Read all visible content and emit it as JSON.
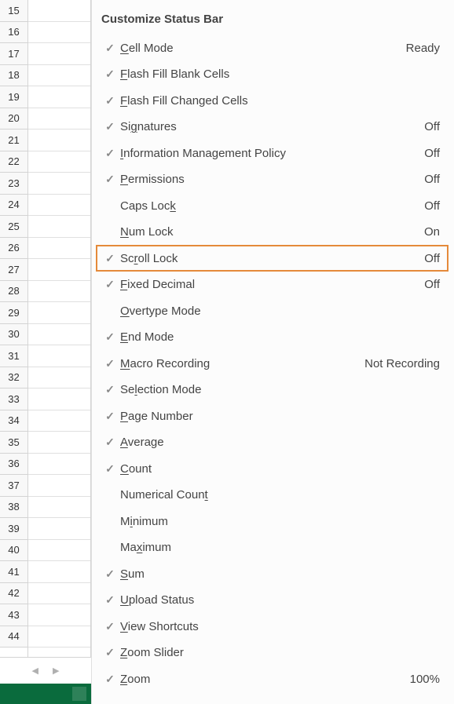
{
  "rows": [
    "15",
    "16",
    "17",
    "18",
    "19",
    "20",
    "21",
    "22",
    "23",
    "24",
    "25",
    "26",
    "27",
    "28",
    "29",
    "30",
    "31",
    "32",
    "33",
    "34",
    "35",
    "36",
    "37",
    "38",
    "39",
    "40",
    "41",
    "42",
    "43",
    "44"
  ],
  "menu": {
    "title": "Customize Status Bar",
    "items": [
      {
        "checked": true,
        "pre": "",
        "u": "C",
        "post": "ell Mode",
        "value": "Ready",
        "highlighted": false
      },
      {
        "checked": true,
        "pre": "",
        "u": "F",
        "post": "lash Fill Blank Cells",
        "value": "",
        "highlighted": false
      },
      {
        "checked": true,
        "pre": "",
        "u": "F",
        "post": "lash Fill Changed Cells",
        "value": "",
        "highlighted": false
      },
      {
        "checked": true,
        "pre": "Si",
        "u": "g",
        "post": "natures",
        "value": "Off",
        "highlighted": false
      },
      {
        "checked": true,
        "pre": "",
        "u": "I",
        "post": "nformation Management Policy",
        "value": "Off",
        "highlighted": false
      },
      {
        "checked": true,
        "pre": "",
        "u": "P",
        "post": "ermissions",
        "value": "Off",
        "highlighted": false
      },
      {
        "checked": false,
        "pre": "Caps Loc",
        "u": "k",
        "post": "",
        "value": "Off",
        "highlighted": false
      },
      {
        "checked": false,
        "pre": "",
        "u": "N",
        "post": "um Lock",
        "value": "On",
        "highlighted": false
      },
      {
        "checked": true,
        "pre": "Sc",
        "u": "r",
        "post": "oll Lock",
        "value": "Off",
        "highlighted": true
      },
      {
        "checked": true,
        "pre": "",
        "u": "F",
        "post": "ixed Decimal",
        "value": "Off",
        "highlighted": false
      },
      {
        "checked": false,
        "pre": "",
        "u": "O",
        "post": "vertype Mode",
        "value": "",
        "highlighted": false
      },
      {
        "checked": true,
        "pre": "",
        "u": "E",
        "post": "nd Mode",
        "value": "",
        "highlighted": false
      },
      {
        "checked": true,
        "pre": "",
        "u": "M",
        "post": "acro Recording",
        "value": "Not Recording",
        "highlighted": false
      },
      {
        "checked": true,
        "pre": "Se",
        "u": "l",
        "post": "ection Mode",
        "value": "",
        "highlighted": false
      },
      {
        "checked": true,
        "pre": "",
        "u": "P",
        "post": "age Number",
        "value": "",
        "highlighted": false
      },
      {
        "checked": true,
        "pre": "",
        "u": "A",
        "post": "verage",
        "value": "",
        "highlighted": false
      },
      {
        "checked": true,
        "pre": "",
        "u": "C",
        "post": "ount",
        "value": "",
        "highlighted": false
      },
      {
        "checked": false,
        "pre": "Numerical Coun",
        "u": "t",
        "post": "",
        "value": "",
        "highlighted": false
      },
      {
        "checked": false,
        "pre": "M",
        "u": "i",
        "post": "nimum",
        "value": "",
        "highlighted": false
      },
      {
        "checked": false,
        "pre": "Ma",
        "u": "x",
        "post": "imum",
        "value": "",
        "highlighted": false
      },
      {
        "checked": true,
        "pre": "",
        "u": "S",
        "post": "um",
        "value": "",
        "highlighted": false
      },
      {
        "checked": true,
        "pre": "",
        "u": "U",
        "post": "pload Status",
        "value": "",
        "highlighted": false
      },
      {
        "checked": true,
        "pre": "",
        "u": "V",
        "post": "iew Shortcuts",
        "value": "",
        "highlighted": false
      },
      {
        "checked": true,
        "pre": "",
        "u": "Z",
        "post": "oom Slider",
        "value": "",
        "highlighted": false
      },
      {
        "checked": true,
        "pre": "",
        "u": "Z",
        "post": "oom",
        "value": "100%",
        "highlighted": false
      }
    ]
  },
  "checkmark_glyph": "✓"
}
